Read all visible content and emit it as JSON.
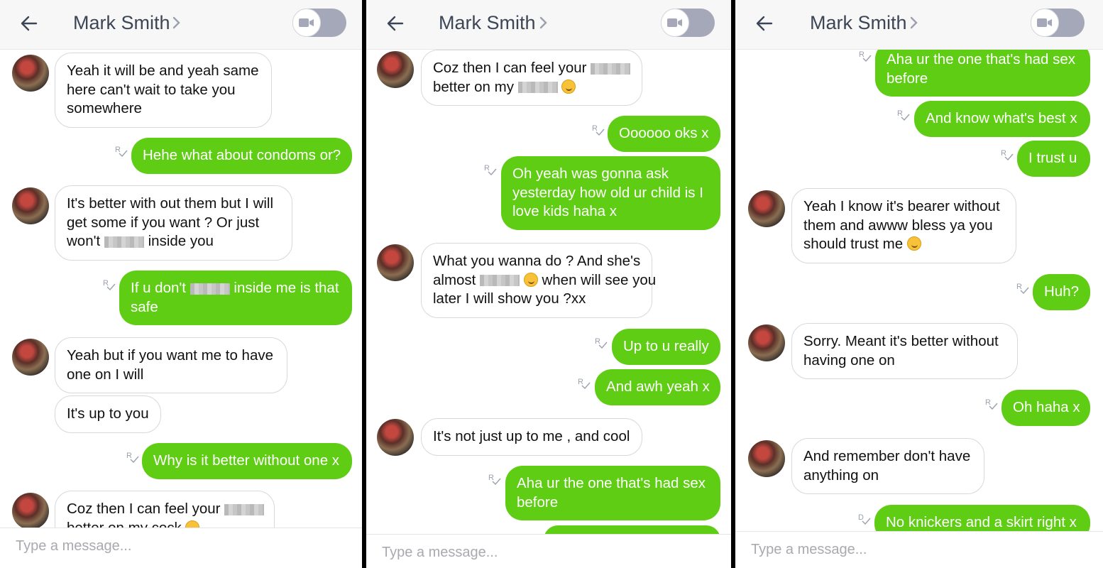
{
  "colors": {
    "outgoing_bubble": "#5fcd14",
    "incoming_bubble": "#ffffff",
    "header_bg": "#f7f7f7",
    "toggle": "#a4a8b8"
  },
  "icons": {
    "back": "arrow-left-icon",
    "chevron": "chevron-right-icon",
    "video": "video-camera-icon",
    "read_receipt": "read-receipt-icon",
    "delivered": "delivered-icon",
    "emoji": "smiling-emoji-icon"
  },
  "panels": [
    {
      "header": {
        "title": "Mark Smith"
      },
      "input": {
        "placeholder": "Type a message..."
      },
      "messages": [
        {
          "dir": "in",
          "lines": [
            "Yeah it will be and yeah same",
            "here can't wait to take you",
            "somewhere"
          ]
        },
        {
          "dir": "out",
          "lines": [
            "Hehe what about condoms or?"
          ],
          "receipt": "R"
        },
        {
          "dir": "in",
          "lines": [
            "It's better with out them but I will",
            "get some if you want ? Or just",
            "won't [redacted] inside you"
          ]
        },
        {
          "dir": "out",
          "lines": [
            "If u don't [redacted] inside me is that",
            "safe"
          ],
          "receipt": "R"
        },
        {
          "dir": "in",
          "lines": [
            "Yeah but if you want me to have",
            "one on I will"
          ]
        },
        {
          "dir": "in",
          "lines": [
            "It's up to you"
          ]
        },
        {
          "dir": "out",
          "lines": [
            "Why is it better without one x"
          ],
          "receipt": "R"
        },
        {
          "dir": "in",
          "lines": [
            "Coz then I can feel your [redacted]",
            "better on my cock [emoji]"
          ]
        }
      ]
    },
    {
      "header": {
        "title": "Mark Smith"
      },
      "input": {
        "placeholder": "Type a message..."
      },
      "messages": [
        {
          "dir": "in",
          "lines": [
            "Coz then I can feel your [redacted]",
            "better on my [redacted] [emoji]"
          ]
        },
        {
          "dir": "out",
          "lines": [
            "Oooooo oks x"
          ],
          "receipt": "R"
        },
        {
          "dir": "out",
          "lines": [
            "Oh yeah was gonna ask",
            "yesterday how old ur child is I",
            "love kids haha x"
          ],
          "receipt": "R"
        },
        {
          "dir": "in",
          "lines": [
            "What you wanna do ? And she's",
            "almost [redacted] [emoji] when will see you",
            "later I will show you ?xx"
          ]
        },
        {
          "dir": "out",
          "lines": [
            "Up to u really"
          ],
          "receipt": "R"
        },
        {
          "dir": "out",
          "lines": [
            "And awh yeah x"
          ],
          "receipt": "R"
        },
        {
          "dir": "in",
          "lines": [
            "It's not just up to me , and cool"
          ]
        },
        {
          "dir": "out",
          "lines": [
            "Aha ur the one that's had sex",
            "before"
          ],
          "receipt": "R"
        }
      ]
    },
    {
      "header": {
        "title": "Mark Smith"
      },
      "input": {
        "placeholder": "Type a message..."
      },
      "messages": [
        {
          "dir": "out",
          "lines": [
            "Aha ur the one that's had sex",
            "before"
          ],
          "receipt": "R"
        },
        {
          "dir": "out",
          "lines": [
            "And know what's best x"
          ],
          "receipt": "R"
        },
        {
          "dir": "out",
          "lines": [
            "I trust u"
          ],
          "receipt": "R"
        },
        {
          "dir": "in",
          "lines": [
            "Yeah I know it's bearer without",
            "them and awww bless ya you",
            "should trust me [emoji]"
          ]
        },
        {
          "dir": "out",
          "lines": [
            "Huh?"
          ],
          "receipt": "R"
        },
        {
          "dir": "in",
          "lines": [
            "Sorry. Meant it's better without",
            "having one on"
          ]
        },
        {
          "dir": "out",
          "lines": [
            "Oh haha x"
          ],
          "receipt": "R"
        },
        {
          "dir": "in",
          "lines": [
            "And remember don't have",
            "anything on"
          ]
        },
        {
          "dir": "out",
          "lines": [
            "No knickers and a skirt right x"
          ],
          "receipt": "D"
        }
      ]
    }
  ]
}
